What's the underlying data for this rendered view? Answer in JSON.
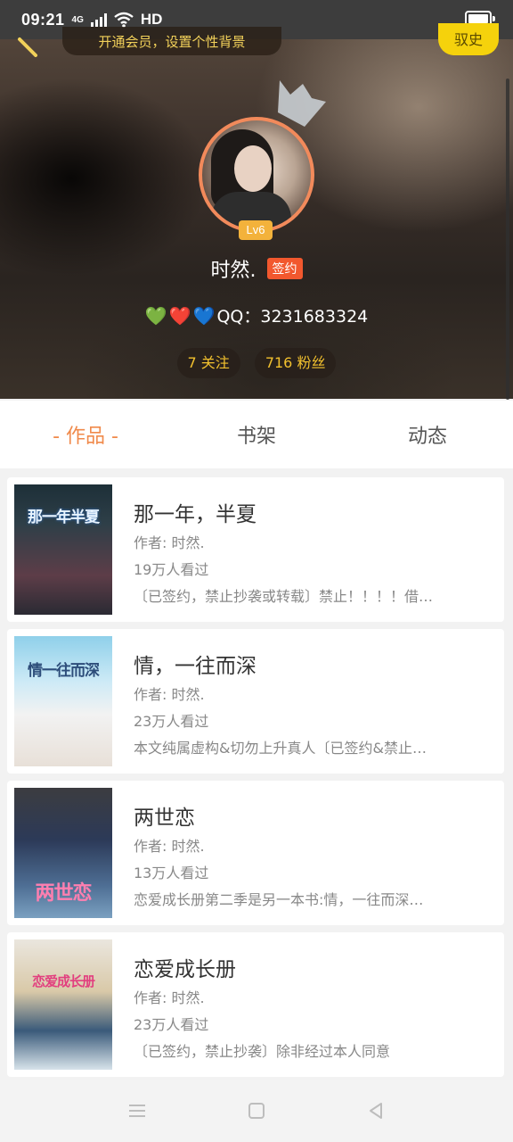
{
  "status_bar": {
    "time": "09:21",
    "network": "4G",
    "hd": "HD"
  },
  "header": {
    "promo_text": "开通会员，设置个性背景",
    "buy_label": "驭史"
  },
  "profile": {
    "level": "Lv6",
    "name": "时然.",
    "signed_badge": "签约",
    "hearts": [
      "💚",
      "❤️",
      "💙"
    ],
    "qq_text": "QQ：3231683324",
    "following": "7 关注",
    "fans": "716 粉丝"
  },
  "tabs": [
    {
      "label": "- 作品 -",
      "active": true
    },
    {
      "label": "书架",
      "active": false
    },
    {
      "label": "动态",
      "active": false
    }
  ],
  "books": [
    {
      "title": "那一年，半夏",
      "author": "作者: 时然.",
      "views": "19万人看过",
      "desc": "〔已签约，禁止抄袭或转载〕禁止！！！！借…",
      "cover_title": "那一年半夏",
      "cover_colors": [
        "#203640",
        "#7a4a5a"
      ]
    },
    {
      "title": "情，一往而深",
      "author": "作者: 时然.",
      "views": "23万人看过",
      "desc": "本文纯属虚构&切勿上升真人〔已签约&禁止…",
      "cover_title": "情一往而深",
      "cover_colors": [
        "#9fd5ea",
        "#d9eef7"
      ]
    },
    {
      "title": "两世恋",
      "author": "作者: 时然.",
      "views": "13万人看过",
      "desc": "恋爱成长册第二季是另一本书:情，一往而深…",
      "cover_title": "两世恋",
      "cover_colors": [
        "#2c3550",
        "#4a6a8c"
      ]
    },
    {
      "title": "恋爱成长册",
      "author": "作者: 时然.",
      "views": "23万人看过",
      "desc": "〔已签约，禁止抄袭〕除非经过本人同意",
      "cover_title": "恋爱成长册",
      "cover_colors": [
        "#e9e4dc",
        "#c9a874"
      ]
    }
  ],
  "colors": {
    "accent": "#f08a4b",
    "signed_badge": "#f2582e",
    "level_badge": "#f3b23b",
    "stat_text": "#f2c12e",
    "buy_button": "#f5d20c"
  }
}
